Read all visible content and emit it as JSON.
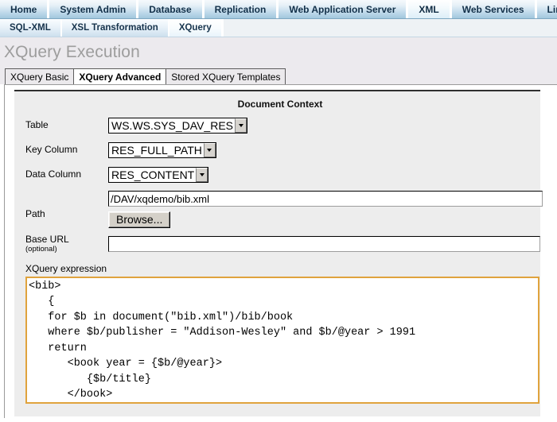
{
  "nav_primary": {
    "items": [
      {
        "label": "Home",
        "active": false
      },
      {
        "label": "System Admin",
        "active": false
      },
      {
        "label": "Database",
        "active": false
      },
      {
        "label": "Replication",
        "active": false
      },
      {
        "label": "Web Application Server",
        "active": false
      },
      {
        "label": "XML",
        "active": true
      },
      {
        "label": "Web Services",
        "active": false
      },
      {
        "label": "Linked Data",
        "active": false
      }
    ]
  },
  "nav_secondary": {
    "items": [
      {
        "label": "SQL-XML",
        "active": false
      },
      {
        "label": "XSL Transformation",
        "active": false
      },
      {
        "label": "XQuery",
        "active": true
      }
    ]
  },
  "page": {
    "title": "XQuery Execution"
  },
  "nav_tertiary": {
    "items": [
      {
        "label": "XQuery Basic",
        "active": false
      },
      {
        "label": "XQuery Advanced",
        "active": true
      },
      {
        "label": "Stored XQuery Templates",
        "active": false
      }
    ]
  },
  "form": {
    "section_title": "Document Context",
    "table": {
      "label": "Table",
      "value": "WS.WS.SYS_DAV_RES",
      "options": [
        "WS.WS.SYS_DAV_RES"
      ]
    },
    "key_column": {
      "label": "Key Column",
      "value": "RES_FULL_PATH",
      "options": [
        "RES_FULL_PATH"
      ]
    },
    "data_column": {
      "label": "Data Column",
      "value": "RES_CONTENT",
      "options": [
        "RES_CONTENT"
      ]
    },
    "path": {
      "label": "Path",
      "value": "/DAV/xqdemo/bib.xml",
      "placeholder": "",
      "browse_label": "Browse..."
    },
    "base_url": {
      "label": "Base URL",
      "sublabel": "(optional)",
      "value": "",
      "placeholder": ""
    },
    "xquery": {
      "label": "XQuery expression",
      "value": "<bib>\n   {\n   for $b in document(\"bib.xml\")/bib/book\n   where $b/publisher = \"Addison-Wesley\" and $b/@year > 1991\n   return\n      <book year = {$b/@year}>\n         {$b/title}\n      </book>\n   }\n  ."
    }
  },
  "colors": {
    "nav_accent": "#a2c7dd",
    "title_text": "#9d9d9d",
    "panel_bg": "#ededed",
    "code_border": "#e0a33d"
  }
}
